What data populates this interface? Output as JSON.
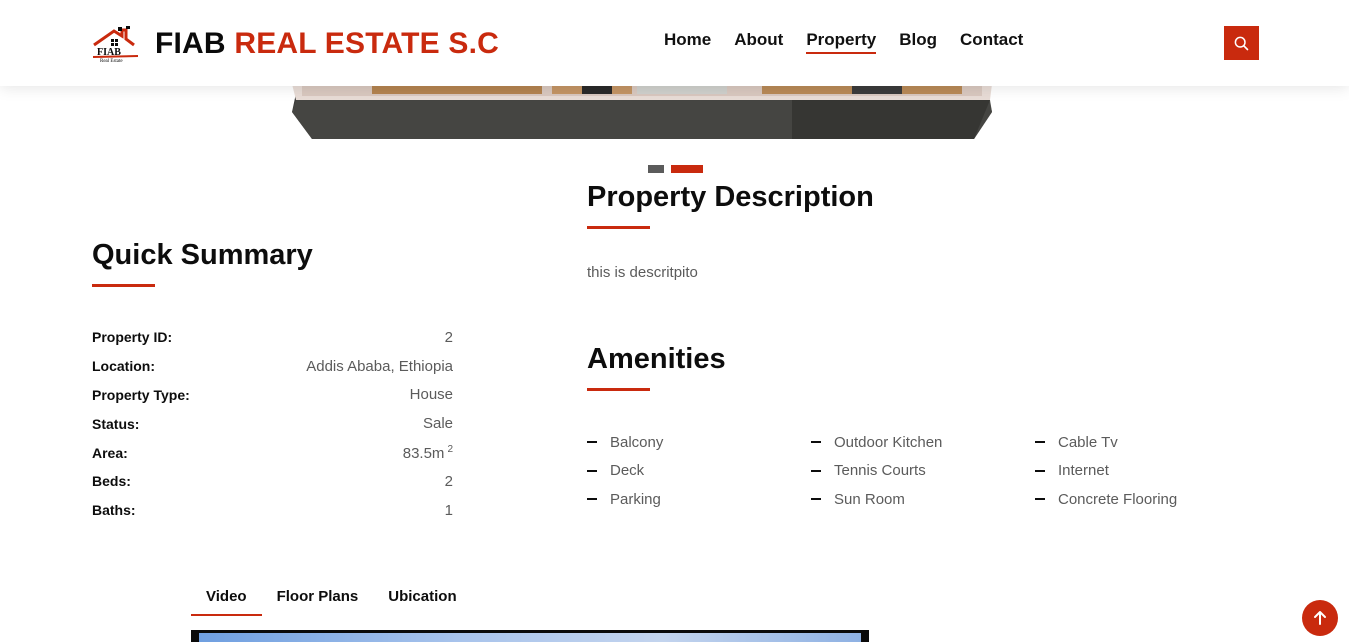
{
  "brand": {
    "name_part1": "FIAB",
    "name_part2": "REAL ESTATE S.C",
    "logo_mark_text": "FIAB",
    "logo_mark_subtext": "Real Estate",
    "accent_color": "#c92a0e"
  },
  "nav": {
    "items": [
      {
        "label": "Home"
      },
      {
        "label": "About"
      },
      {
        "label": "Property",
        "active": true
      },
      {
        "label": "Blog"
      },
      {
        "label": "Contact"
      }
    ],
    "search_icon": "search-icon"
  },
  "carousel": {
    "active_index": 1,
    "count": 2
  },
  "summary": {
    "title": "Quick Summary",
    "rows": [
      {
        "label": "Property ID:",
        "value": "2"
      },
      {
        "label": "Location:",
        "value": "Addis Ababa, Ethiopia"
      },
      {
        "label": "Property Type:",
        "value": "House"
      },
      {
        "label": "Status:",
        "value": "Sale"
      },
      {
        "label": "Area:",
        "value": "83.5m",
        "sup": "2"
      },
      {
        "label": "Beds:",
        "value": "2"
      },
      {
        "label": "Baths:",
        "value": "1"
      }
    ]
  },
  "description": {
    "title": "Property Description",
    "text": "this is descritpito"
  },
  "amenities": {
    "title": "Amenities",
    "columns": [
      [
        "Balcony",
        "Deck",
        "Parking"
      ],
      [
        "Outdoor Kitchen",
        "Tennis Courts",
        "Sun Room"
      ],
      [
        "Cable Tv",
        "Internet",
        "Concrete Flooring"
      ]
    ]
  },
  "tabs": [
    {
      "label": "Video",
      "active": true
    },
    {
      "label": "Floor Plans"
    },
    {
      "label": "Ubication"
    }
  ],
  "back_to_top_icon": "arrow-up-icon"
}
